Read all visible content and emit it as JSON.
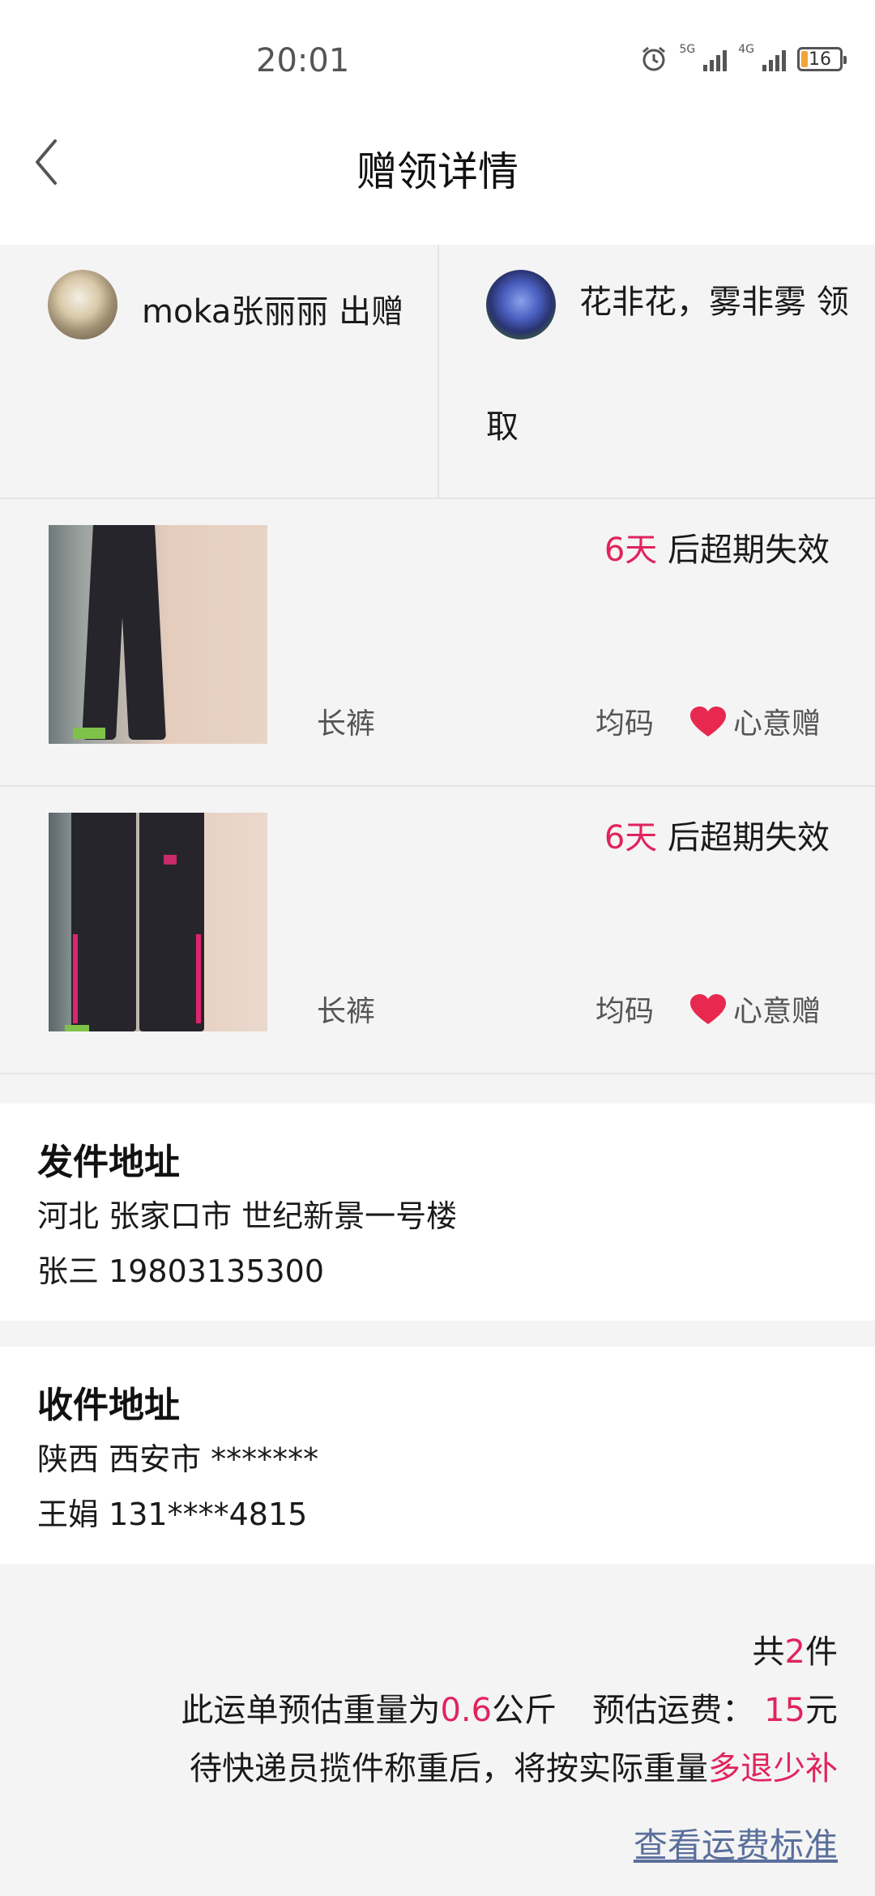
{
  "status_bar": {
    "time": "20:01",
    "net1": "5G",
    "net2": "4G",
    "battery": "16"
  },
  "nav": {
    "title": "赠领详情"
  },
  "parties": {
    "giver": "moka张丽丽 出赠",
    "receiver": "花非花，雾非雾 领取"
  },
  "items": [
    {
      "expiry_days": "6天",
      "expiry_suffix": " 后超期失效",
      "name": "长裤",
      "size": "均码",
      "gift_type": "心意赠"
    },
    {
      "expiry_days": "6天",
      "expiry_suffix": " 后超期失效",
      "name": "长裤",
      "size": "均码",
      "gift_type": "心意赠"
    }
  ],
  "sender_address": {
    "title": "发件地址",
    "line1": "河北 张家口市 世纪新景一号楼",
    "line2": "张三 19803135300"
  },
  "receiver_address": {
    "title": "收件地址",
    "line1": "陕西 西安市 *******",
    "line2": "王娟 131****4815"
  },
  "summary": {
    "count_prefix": "共",
    "count": "2",
    "count_suffix": "件",
    "weight_prefix": "此运单预估重量为",
    "weight": "0.6",
    "weight_unit": "公斤",
    "fee_prefix": "预估运费：",
    "fee": "15",
    "fee_unit": "元",
    "note_prefix": "待快递员揽件称重后，将按实际重量",
    "note_highlight": "多退少补",
    "fee_link": "查看运费标准"
  },
  "colors": {
    "accent": "#e0245e",
    "link": "#5a6f9c"
  }
}
